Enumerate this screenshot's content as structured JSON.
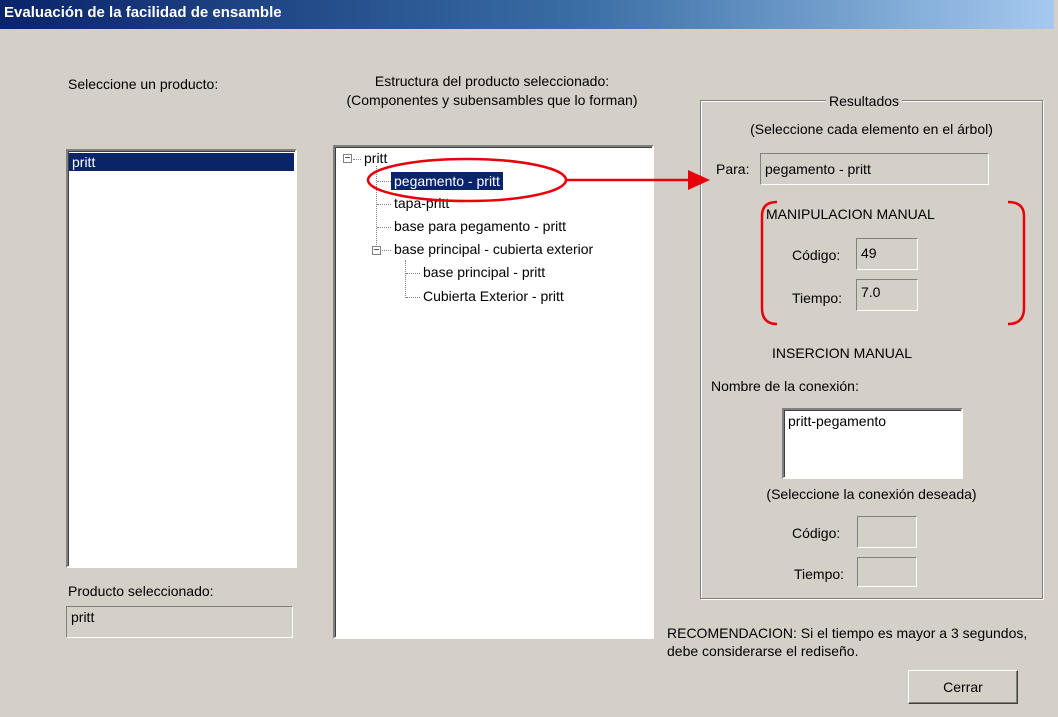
{
  "window": {
    "title": "Evaluación de la facilidad de ensamble"
  },
  "product_panel": {
    "label": "Seleccione un producto:",
    "items": [
      "pritt"
    ],
    "selected_label": "Producto seleccionado:",
    "selected_value": "pritt"
  },
  "structure_panel": {
    "label_line1": "Estructura del producto seleccionado:",
    "label_line2": "(Componentes y subensambles que lo forman)",
    "tree": {
      "root": "pritt",
      "nodes": [
        "pegamento - pritt",
        "tapa-pritt",
        "base para pegamento - pritt",
        "base principal - cubierta exterior"
      ],
      "subnodes": [
        "base principal - pritt",
        "Cubierta Exterior - pritt"
      ],
      "selected": "pegamento - pritt"
    }
  },
  "results": {
    "legend": "Resultados",
    "hint": "(Seleccione cada elemento en el árbol)",
    "para_label": "Para:",
    "para_value": "pegamento - pritt",
    "manipulacion": {
      "title": "MANIPULACION MANUAL",
      "codigo_label": "Código:",
      "codigo_value": "49",
      "tiempo_label": "Tiempo:",
      "tiempo_value": "7.0"
    },
    "insercion": {
      "title": "INSERCION MANUAL",
      "conexion_label": "Nombre de la conexión:",
      "conexiones": [
        "pritt-pegamento"
      ],
      "conexion_hint": "(Seleccione la conexión deseada)",
      "codigo_label": "Código:",
      "codigo_value": "",
      "tiempo_label": "Tiempo:",
      "tiempo_value": ""
    }
  },
  "recommendation": {
    "line1": "RECOMENDACION: Si el tiempo es mayor a 3 segundos,",
    "line2": "debe considerarse el rediseño."
  },
  "buttons": {
    "close_label": "Cerrar"
  },
  "annotation_colors": {
    "highlight": "#e8000b"
  }
}
